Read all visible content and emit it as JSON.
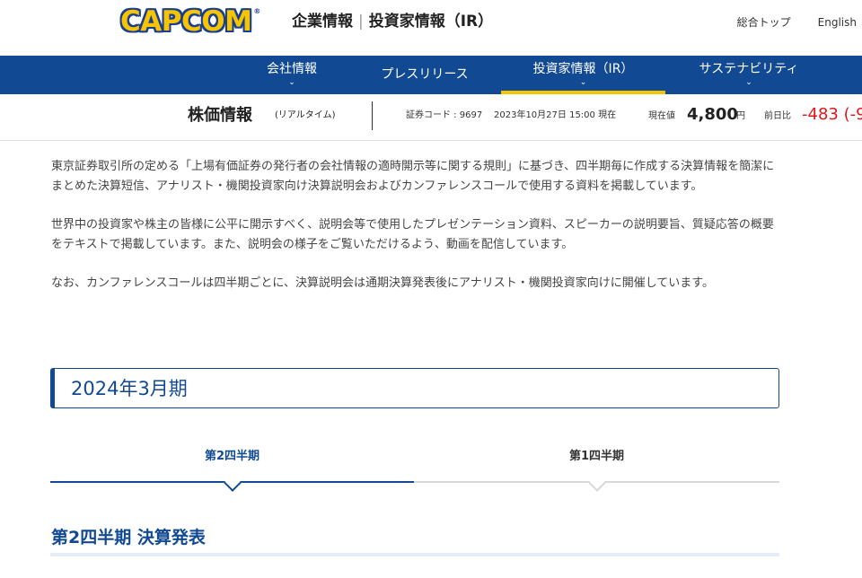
{
  "header": {
    "logo_text": "CAPCOM",
    "logo_mark": "®",
    "site_title_1": "企業情報",
    "site_title_sep": "|",
    "site_title_2": "投資家情報（IR）",
    "top_links": [
      "総合トップ",
      "English"
    ]
  },
  "nav": {
    "items": [
      {
        "label": "会社情報",
        "has_dropdown": true
      },
      {
        "label": "プレスリリース",
        "has_dropdown": false
      },
      {
        "label": "投資家情報（IR）",
        "has_dropdown": true,
        "active": true
      },
      {
        "label": "サステナビリティ",
        "has_dropdown": true
      }
    ],
    "chevron": "⌄"
  },
  "stock": {
    "title": "株価情報",
    "subtitle": "(リアルタイム)",
    "code": "証券コード : 9697",
    "datetime": "2023年10月27日 15:00 現在",
    "current_label": "現在値",
    "price": "4,800",
    "unit": "円",
    "prev_label": "前日比",
    "change": "-483 (-9",
    "change_color": "#e1161b"
  },
  "intro": {
    "p1": "東京証券取引所の定める「上場有価証券の発行者の会社情報の適時開示等に関する規則」に基づき、四半期毎に作成する決算情報を簡潔にまとめた決算短信、アナリスト・機関投資家向け決算説明会およびカンファレンスコールで使用する資料を掲載しています。",
    "p2": "世界中の投資家や株主の皆様に公平に開示すべく、説明会等で使用したプレゼンテーション資料、スピーカーの説明要旨、質疑応答の概要をテキストで掲載しています。また、説明会の様子をご覧いただけるよう、動画を配信しています。",
    "p3": "なお、カンファレンスコールは四半期ごとに、決算説明会は通期決算発表後にアナリスト・機関投資家向けに開催しています。"
  },
  "period": {
    "label": "2024年3月期"
  },
  "tabs": [
    {
      "label": "第2四半期",
      "active": true
    },
    {
      "label": "第1四半期",
      "active": false
    }
  ],
  "section": {
    "title": "第2四半期 決算発表"
  },
  "colors": {
    "brand_blue": "#114a93",
    "accent_yellow": "#f6c400"
  }
}
